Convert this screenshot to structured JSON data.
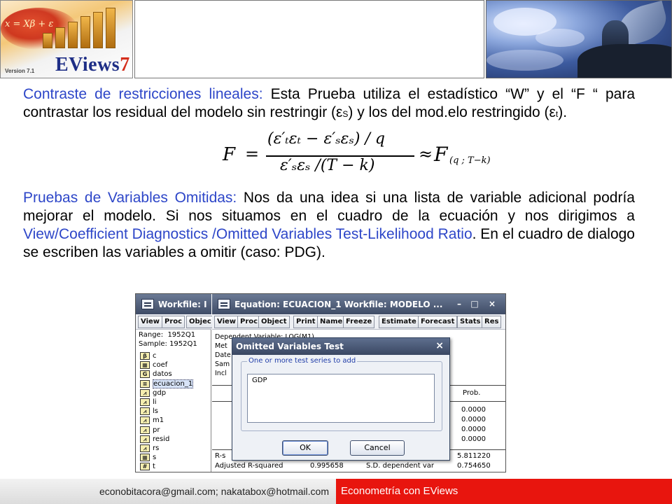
{
  "header": {
    "logo": {
      "brand_main": "EViews",
      "brand_version_digit": "7",
      "version_label": "Version 7.1",
      "formula_text": "x = Xβ + ε"
    }
  },
  "paragraph1": {
    "title": "Contraste de restricciones lineales:",
    "body_a": " Esta Prueba utiliza el estadístico “W” y el “F “ para contrastar los residual del modelo sin restringir (ε",
    "sub_s": "S",
    "body_b": ") y los del mod.elo restringido (ε",
    "sub_t": "t",
    "body_c": ")."
  },
  "formula": {
    "lhs": "F",
    "eq": "=",
    "numerator": "(ε′ₜεₜ − ε′ₛεₛ) / q",
    "denominator": "ε′ₛεₛ /(T − k)",
    "approx": "≈",
    "rhs": "F",
    "rhs_sub": "(q ; T−k)"
  },
  "paragraph2": {
    "title": "Pruebas de Variables Omitidas:",
    "body_a": " Nos da una idea si una lista de variable adicional podría mejorar el modelo. Si nos situamos en el cuadro de la ecuación y nos dirigimos a ",
    "link": "View/Coefficient Diagnostics /Omitted Variables Test-Likelihood Ratio",
    "body_b": ". En el cuadro de dialogo se escriben las variables a omitir (caso: PDG)."
  },
  "workfile": {
    "title": "Workfile: I",
    "toolbar": [
      "View",
      "Proc",
      "Objec"
    ],
    "range_label": "Range:",
    "range_value": "1952Q1",
    "sample_label": "Sample:",
    "sample_value": "1952Q1",
    "items": [
      {
        "icon": "β",
        "name": "c"
      },
      {
        "icon": "▦",
        "name": "coef"
      },
      {
        "icon": "G",
        "name": "datos"
      },
      {
        "icon": "≡",
        "name": "ecuacion_1"
      },
      {
        "icon": "⩘",
        "name": "gdp"
      },
      {
        "icon": "⩘",
        "name": "li"
      },
      {
        "icon": "⩘",
        "name": "ls"
      },
      {
        "icon": "⩘",
        "name": "m1"
      },
      {
        "icon": "⩘",
        "name": "pr"
      },
      {
        "icon": "⩘",
        "name": "resid"
      },
      {
        "icon": "⩘",
        "name": "rs"
      },
      {
        "icon": "▦",
        "name": "s"
      },
      {
        "icon": "#",
        "name": "t"
      }
    ]
  },
  "equation": {
    "title": "Equation: ECUACION_1    Workfile: MODELO ...",
    "toolbar": [
      "View",
      "Proc",
      "Object",
      "Print",
      "Name",
      "Freeze",
      "Estimate",
      "Forecast",
      "Stats",
      "Res"
    ],
    "partial_lines": [
      "Dependent Variable: LOG(M1)",
      "Met",
      "Date",
      "Sam",
      "Incl"
    ],
    "prob_header": "Prob.",
    "prob_values": [
      "0.0000",
      "0.0000",
      "0.0000",
      "0.0000"
    ],
    "rsq_label": "R-s",
    "rsq_value": "5.811220",
    "adj_label": "Adjusted R-squared",
    "adj_partial": "0.995658",
    "sd_label": "S.D. dependent var",
    "sd_value": "0.754650"
  },
  "dialog": {
    "title": "Omitted Variables Test",
    "close": "×",
    "group_label": "One or more test series to add",
    "input_value": "GDP",
    "ok_label": "OK",
    "cancel_label": "Cancel"
  },
  "footer": {
    "emails": "econobitacora@gmail.com;  nakatabox@hotmail.com",
    "course": "Econometría con EViews"
  },
  "colors": {
    "highlight_blue": "#2d46c8",
    "footer_red": "#e8150e"
  }
}
